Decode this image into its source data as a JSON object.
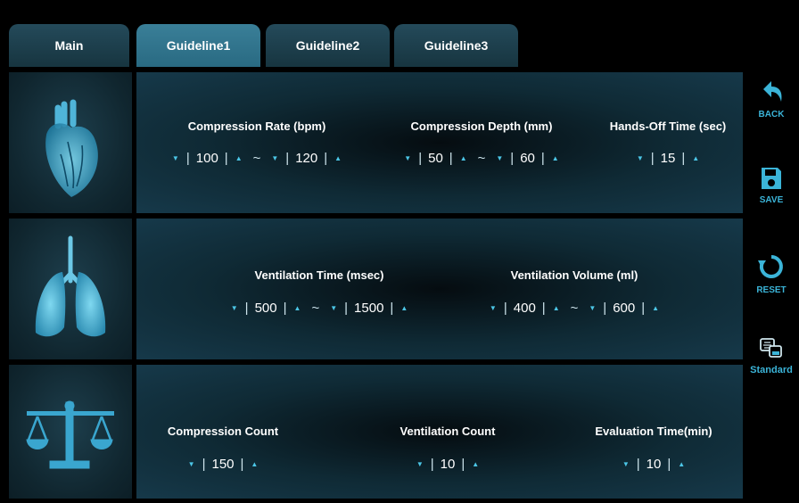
{
  "tabs": [
    {
      "label": "Main"
    },
    {
      "label": "Guideline1"
    },
    {
      "label": "Guideline2"
    },
    {
      "label": "Guideline3"
    }
  ],
  "active_tab": "Guideline1",
  "rows": {
    "compression": {
      "icon": "heart-icon",
      "rate": {
        "label": "Compression Rate (bpm)",
        "min": "100",
        "max": "120"
      },
      "depth": {
        "label": "Compression Depth (mm)",
        "min": "50",
        "max": "60"
      },
      "hands_off": {
        "label": "Hands-Off Time (sec)",
        "value": "15"
      }
    },
    "ventilation": {
      "icon": "lungs-icon",
      "time": {
        "label": "Ventilation Time (msec)",
        "min": "500",
        "max": "1500"
      },
      "volume": {
        "label": "Ventilation Volume (ml)",
        "min": "400",
        "max": "600"
      }
    },
    "evaluation": {
      "icon": "scale-icon",
      "compression_count": {
        "label": "Compression Count",
        "value": "150"
      },
      "ventilation_count": {
        "label": "Ventilation Count",
        "value": "10"
      },
      "evaluation_time": {
        "label": "Evaluation Time(min)",
        "value": "10"
      }
    }
  },
  "sidebar": {
    "back": {
      "label": "BACK",
      "icon": "back-arrow-icon"
    },
    "save": {
      "label": "SAVE",
      "icon": "floppy-disk-icon"
    },
    "reset": {
      "label": "RESET",
      "icon": "reset-icon"
    },
    "standard": {
      "label": "Standard",
      "icon": "standard-icon"
    }
  },
  "colors": {
    "accent": "#3bb4d8",
    "active_tab": "#2f7590",
    "panel": "#16394a"
  },
  "glyphs": {
    "down": "▼",
    "up": "▲",
    "bar": "|",
    "tilde": "~"
  }
}
